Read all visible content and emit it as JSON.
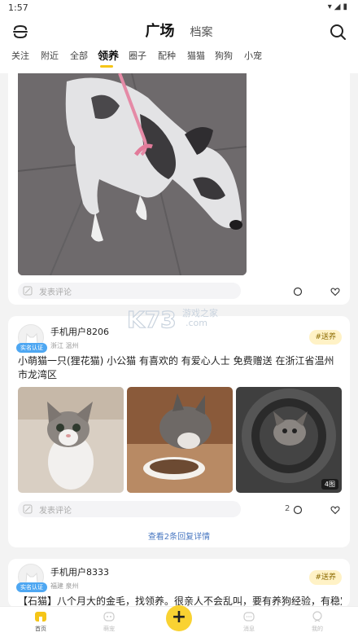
{
  "status": {
    "time": "1:57",
    "icons": "▾◢▮"
  },
  "header": {
    "main_tab": "广场",
    "second_tab": "档案"
  },
  "categories": [
    "关注",
    "附近",
    "全部",
    "领养",
    "圈子",
    "配种",
    "猫猫",
    "狗狗",
    "小宠"
  ],
  "active_category_index": 3,
  "post1": {
    "comment_placeholder": "发表评论"
  },
  "post2": {
    "badge": "实名认证",
    "username": "手机用户8206",
    "location": "浙江 温州",
    "tag": "#送养",
    "text": "小萌猫一只(狸花猫) 小公猫 有喜欢的 有爱心人士 免费赠送  在浙江省温州市龙湾区",
    "image_count": "4图",
    "comment_placeholder": "发表评论",
    "comment_count": "2",
    "reply_link": "查看2条回复详情"
  },
  "post3": {
    "badge": "实名认证",
    "username": "手机用户8333",
    "location": "福建 泉州",
    "tag": "#送养",
    "text": "【石猫】八个月大的金毛，找领养。很亲人不会乱叫，要有养狗经验，有稳定的"
  },
  "watermark": {
    "line1": "游戏之家",
    "line2": ".com",
    "logo": "K73"
  },
  "bottom_nav": {
    "items": [
      "首页",
      "萌宠",
      "",
      "消息",
      "我的"
    ]
  },
  "colors": {
    "accent": "#f9d232",
    "badge": "#4ea7f2",
    "link": "#4a78c2"
  }
}
